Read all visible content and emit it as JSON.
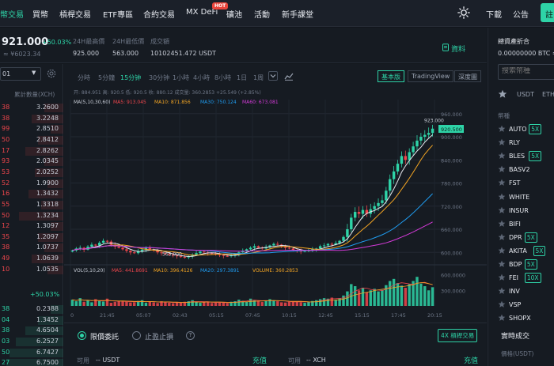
{
  "nav": {
    "items": [
      "幣交易",
      "買幣",
      "槓桿交易",
      "ETF專區",
      "合約交易",
      "MX DeFi",
      "礦池",
      "活動",
      "新手課堂"
    ],
    "hot_badge": "HOT",
    "right_items": [
      "下載",
      "公告"
    ],
    "green_button_label": "註"
  },
  "ticker": {
    "last_price": "921.000",
    "change_pct": "+50.03%",
    "cny_price": "≈ ¥6023.34",
    "stat_labels": [
      "24H最高價",
      "24H最低價",
      "成交額"
    ],
    "stat_values": [
      "925.000",
      "563.000",
      "10102451.472 USDT"
    ],
    "info_link": "資料"
  },
  "orderbook": {
    "depth_value": "01",
    "header_qty": "累計數量(XCH)",
    "asks": [
      {
        "p": "38",
        "q": "3.2600",
        "fill": 0.3
      },
      {
        "p": "38",
        "q": "3.2248",
        "fill": 0.5
      },
      {
        "p": "99",
        "q": "2.8510",
        "fill": 0.2
      },
      {
        "p": "50",
        "q": "2.8412",
        "fill": 0.4
      },
      {
        "p": "17",
        "q": "2.8262",
        "fill": 0.6
      },
      {
        "p": "93",
        "q": "2.0345",
        "fill": 0.3
      },
      {
        "p": "53",
        "q": "2.0252",
        "fill": 0.45
      },
      {
        "p": "52",
        "q": "1.9900",
        "fill": 0.25
      },
      {
        "p": "16",
        "q": "1.3432",
        "fill": 0.55
      },
      {
        "p": "55",
        "q": "1.3318",
        "fill": 0.35
      },
      {
        "p": "50",
        "q": "1.3234",
        "fill": 0.7
      },
      {
        "p": "12",
        "q": "1.3097",
        "fill": 0.2
      },
      {
        "p": "35",
        "q": "1.2097",
        "fill": 0.4
      },
      {
        "p": "38",
        "q": "1.0737",
        "fill": 0.3
      },
      {
        "p": "49",
        "q": "1.0639",
        "fill": 0.5
      },
      {
        "p": "10",
        "q": "1.0535",
        "fill": 0.25
      }
    ],
    "mid_change": "+50.03%",
    "bids": [
      {
        "p": "38",
        "q": "0.2388",
        "fill": 0.2
      },
      {
        "p": "04",
        "q": "1.3452",
        "fill": 0.4
      },
      {
        "p": "38",
        "q": "4.6504",
        "fill": 0.6
      },
      {
        "p": "03",
        "q": "6.2527",
        "fill": 0.75
      },
      {
        "p": "50",
        "q": "6.7427",
        "fill": 0.85
      },
      {
        "p": "27",
        "q": "6.7500",
        "fill": 0.9
      }
    ]
  },
  "chart_toolbar": {
    "timeframes": [
      "分時",
      "5分鐘",
      "15分钟",
      "30分钟",
      "1小時",
      "4小時",
      "8小時",
      "1日",
      "1周"
    ],
    "active_timeframe": "15分钟",
    "views": [
      "基本版",
      "TradingView",
      "深度圖"
    ],
    "active_view": "基本版"
  },
  "chart_data": {
    "type": "candlestick",
    "ohlc_readout": "开: 884.951    高: 920.5    低: 920.5    收: 880.12    成交量: 360.2853    +25.549 (+2.85%)",
    "ma_legend": [
      "MA(5,10,30,60)",
      "MA5: 913.045",
      "MA10: 871.856",
      "MA30: 750.124",
      "MA60: 673.081"
    ],
    "vol_legend": [
      "VOL(5,10,20)",
      "MA5: 441.8691",
      "MA10: 396.4126",
      "MA20: 297.3891",
      "VOLUME: 360.2853"
    ],
    "price_axis": [
      960,
      900,
      840,
      780,
      720,
      660,
      600
    ],
    "price_axis_labels": [
      "960.000",
      "900.000",
      "840.000",
      "780.000",
      "720.000",
      "660.000",
      "600.000"
    ],
    "vol_axis_labels": [
      "600.0000",
      "300.0000"
    ],
    "time_labels": [
      "0",
      "21:45",
      "05:07",
      "02:43",
      "05:15",
      "07:45",
      "10:15",
      "12:45",
      "15:15",
      "17:45",
      "20:15"
    ],
    "ylim": [
      580,
      980
    ],
    "vol_ylim": [
      0,
      700
    ],
    "high_label": "923.000",
    "low_label": "563.000",
    "current_label": "920.500",
    "closes": [
      605,
      610,
      612,
      607,
      615,
      620,
      618,
      625,
      630,
      628,
      620,
      615,
      612,
      608,
      604,
      600,
      598,
      603,
      607,
      612,
      608,
      605,
      600,
      598,
      596,
      594,
      592,
      590,
      588,
      587,
      590,
      594,
      598,
      602,
      600,
      598,
      597,
      595,
      593,
      591,
      590,
      592,
      596,
      600,
      604,
      608,
      612,
      616,
      612,
      610,
      614,
      618,
      622,
      620,
      616,
      612,
      610,
      606,
      604,
      602,
      604,
      606,
      608,
      610,
      616,
      618,
      622,
      620,
      624,
      630,
      640,
      660,
      690,
      705,
      700,
      710,
      700,
      712,
      720,
      728,
      735,
      760,
      790,
      810,
      830,
      850,
      840,
      860,
      875,
      890,
      900,
      905,
      910,
      921
    ],
    "volumes": [
      120,
      90,
      150,
      80,
      110,
      70,
      130,
      95,
      85,
      140,
      60,
      75,
      100,
      90,
      80,
      65,
      70,
      95,
      110,
      60,
      85,
      70,
      55,
      90,
      75,
      60,
      50,
      70,
      65,
      80,
      90,
      110,
      75,
      60,
      70,
      85,
      55,
      65,
      70,
      60,
      50,
      80,
      90,
      120,
      100,
      85,
      140,
      110,
      90,
      75,
      95,
      130,
      110,
      90,
      70,
      65,
      80,
      85,
      90,
      70,
      60,
      75,
      95,
      110,
      130,
      150,
      140,
      160,
      120,
      150,
      200,
      280,
      420,
      380,
      300,
      350,
      260,
      300,
      330,
      280,
      310,
      400,
      480,
      520,
      440,
      390,
      350,
      420,
      480,
      560,
      430,
      380,
      300,
      360
    ]
  },
  "order_form": {
    "limit_label": "限價委託",
    "stop_label": "止盈止損",
    "isolated_tag": "4X 槓桿交易",
    "avail_label": "可用",
    "avail_usdt": "-- USDT",
    "avail_xch": "-- XCH",
    "deposit": "充值"
  },
  "right_panel": {
    "est_label": "總資產折合",
    "est_value": "0.00000000 BTC ≈",
    "search_placeholder": "搜索幣種",
    "market_tabs": [
      "USDT",
      "ETH"
    ],
    "pair_header": "幣種",
    "pairs": [
      {
        "name": "AUTO",
        "lev": "5X"
      },
      {
        "name": "RLY",
        "lev": ""
      },
      {
        "name": "BLES",
        "lev": "5X"
      },
      {
        "name": "BASV2",
        "lev": ""
      },
      {
        "name": "FST",
        "lev": ""
      },
      {
        "name": "WHITE",
        "lev": ""
      },
      {
        "name": "INSUR",
        "lev": ""
      },
      {
        "name": "BIFI",
        "lev": ""
      },
      {
        "name": "DPR",
        "lev": "5X"
      },
      {
        "name": "AKITA",
        "lev": "5X"
      },
      {
        "name": "BDP",
        "lev": "5X"
      },
      {
        "name": "FEI",
        "lev": "10X"
      },
      {
        "name": "INV",
        "lev": ""
      },
      {
        "name": "VSP",
        "lev": ""
      },
      {
        "name": "SHOPX",
        "lev": ""
      }
    ],
    "trades_title": "實時成交",
    "trades_head": "價格(USDT)"
  },
  "colors": {
    "accent": "#2ed3a7",
    "down": "#f0464c",
    "ma5": "#e6e9ef",
    "ma10": "#f5a623",
    "ma30": "#1f9cf0",
    "ma60": "#d43ad8"
  }
}
